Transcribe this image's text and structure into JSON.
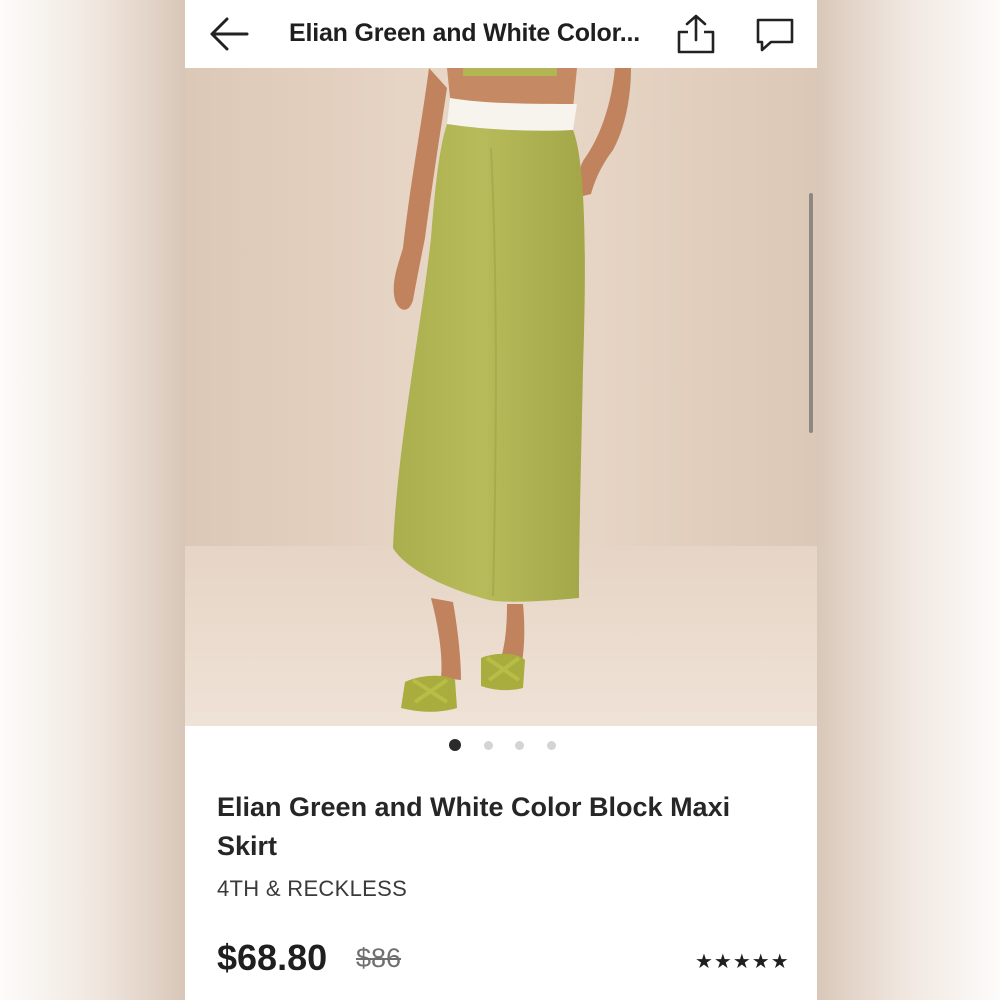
{
  "header": {
    "title": "Elian Green and White Color...",
    "back_icon": "arrow-left-icon",
    "share_icon": "share-upload-icon",
    "comment_icon": "comment-bubble-icon"
  },
  "image_carousel": {
    "total_slides": 4,
    "active_slide": 1
  },
  "product": {
    "name": "Elian Green and White Color Block Maxi Skirt",
    "brand": "4TH & RECKLESS",
    "price": "$68.80",
    "original_price": "$86",
    "rating_stars": "★★★★★",
    "rating": 5
  },
  "colors": {
    "skirt": "#b2b554",
    "waistband": "#f7f4ee",
    "backdrop": "#e3d0bf",
    "skin": "#c0835e"
  }
}
